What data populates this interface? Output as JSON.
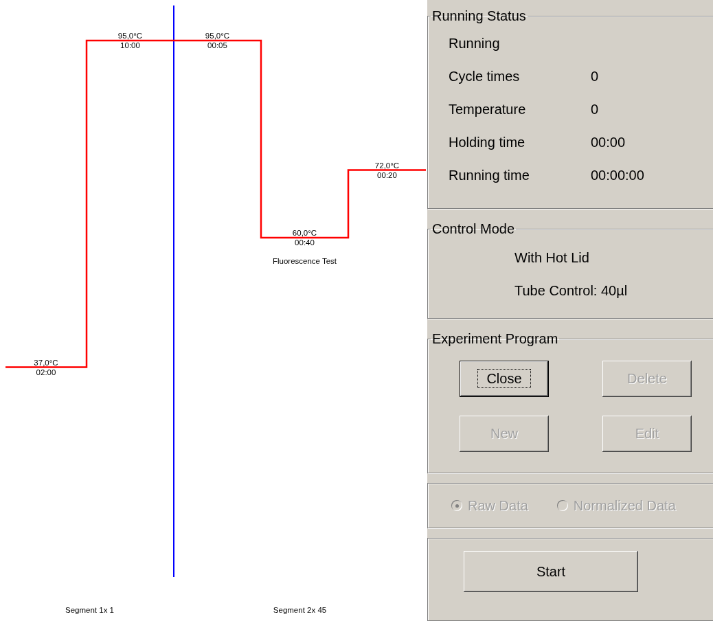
{
  "profile": {
    "segments": [
      {
        "label": "Segment 1x 1",
        "steps": [
          {
            "temperature": "37,0°C",
            "time": "02:00"
          },
          {
            "temperature": "95,0°C",
            "time": "10:00"
          }
        ]
      },
      {
        "label": "Segment 2x 45",
        "steps": [
          {
            "temperature": "95,0°C",
            "time": "00:05"
          },
          {
            "temperature": "60,0°C",
            "time": "00:40",
            "note": "Fluorescence Test"
          },
          {
            "temperature": "72,0°C",
            "time": "00:20"
          }
        ]
      }
    ]
  },
  "running_status": {
    "title": "Running Status",
    "state": "Running",
    "rows": [
      {
        "label": "Cycle times",
        "value": "0"
      },
      {
        "label": "Temperature",
        "value": "0"
      },
      {
        "label": "Holding time",
        "value": "00:00"
      },
      {
        "label": "Running time",
        "value": "00:00:00"
      }
    ]
  },
  "control_mode": {
    "title": "Control Mode",
    "lines": [
      "With Hot Lid",
      "Tube Control: 40µl"
    ]
  },
  "experiment_program": {
    "title": "Experiment Program",
    "buttons": [
      {
        "label": "Close",
        "disabled": false,
        "focused": true
      },
      {
        "label": "Delete",
        "disabled": true,
        "focused": false
      },
      {
        "label": "New",
        "disabled": true,
        "focused": false
      },
      {
        "label": "Edit",
        "disabled": true,
        "focused": false
      }
    ]
  },
  "data_mode": {
    "disabled": true,
    "options": [
      {
        "label": "Raw Data",
        "selected": true
      },
      {
        "label": "Normalized Data",
        "selected": false
      }
    ]
  },
  "start_button": {
    "label": "Start"
  }
}
